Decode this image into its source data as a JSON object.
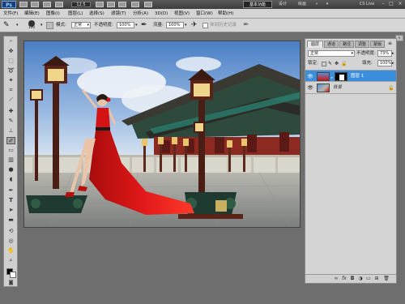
{
  "appbar": {
    "logo": "Ps",
    "zoom": "12.5",
    "workspace_active": "基本功能",
    "workspace_others": [
      "设计",
      "绘画"
    ],
    "cs_live": "CS Live"
  },
  "menu": [
    "文件(F)",
    "编辑(E)",
    "图像(I)",
    "图层(L)",
    "选择(S)",
    "滤镜(T)",
    "分析(A)",
    "3D(D)",
    "视图(V)",
    "窗口(W)",
    "帮助(H)"
  ],
  "options": {
    "brush_size": "100",
    "mode_label": "模式:",
    "mode_value": "正常",
    "opacity_label": "不透明度:",
    "opacity_value": "100%",
    "flow_label": "流量:",
    "flow_value": "100%",
    "history_label": "抹到历史记录"
  },
  "layers_panel": {
    "tabs": [
      "图层",
      "通道",
      "路径",
      "调整",
      "蒙版"
    ],
    "blend_mode": "正常",
    "opacity_label": "不透明度:",
    "opacity_value": "73%",
    "lock_label": "锁定:",
    "fill_label": "填充:",
    "fill_value": "100%",
    "layers": [
      {
        "name": "图层 1",
        "selected": true
      },
      {
        "name": "背景",
        "selected": false
      }
    ]
  },
  "colors": {
    "selected_layer": "#3a8edb",
    "dress": "#d41414",
    "sky": "#5b8fd0"
  }
}
